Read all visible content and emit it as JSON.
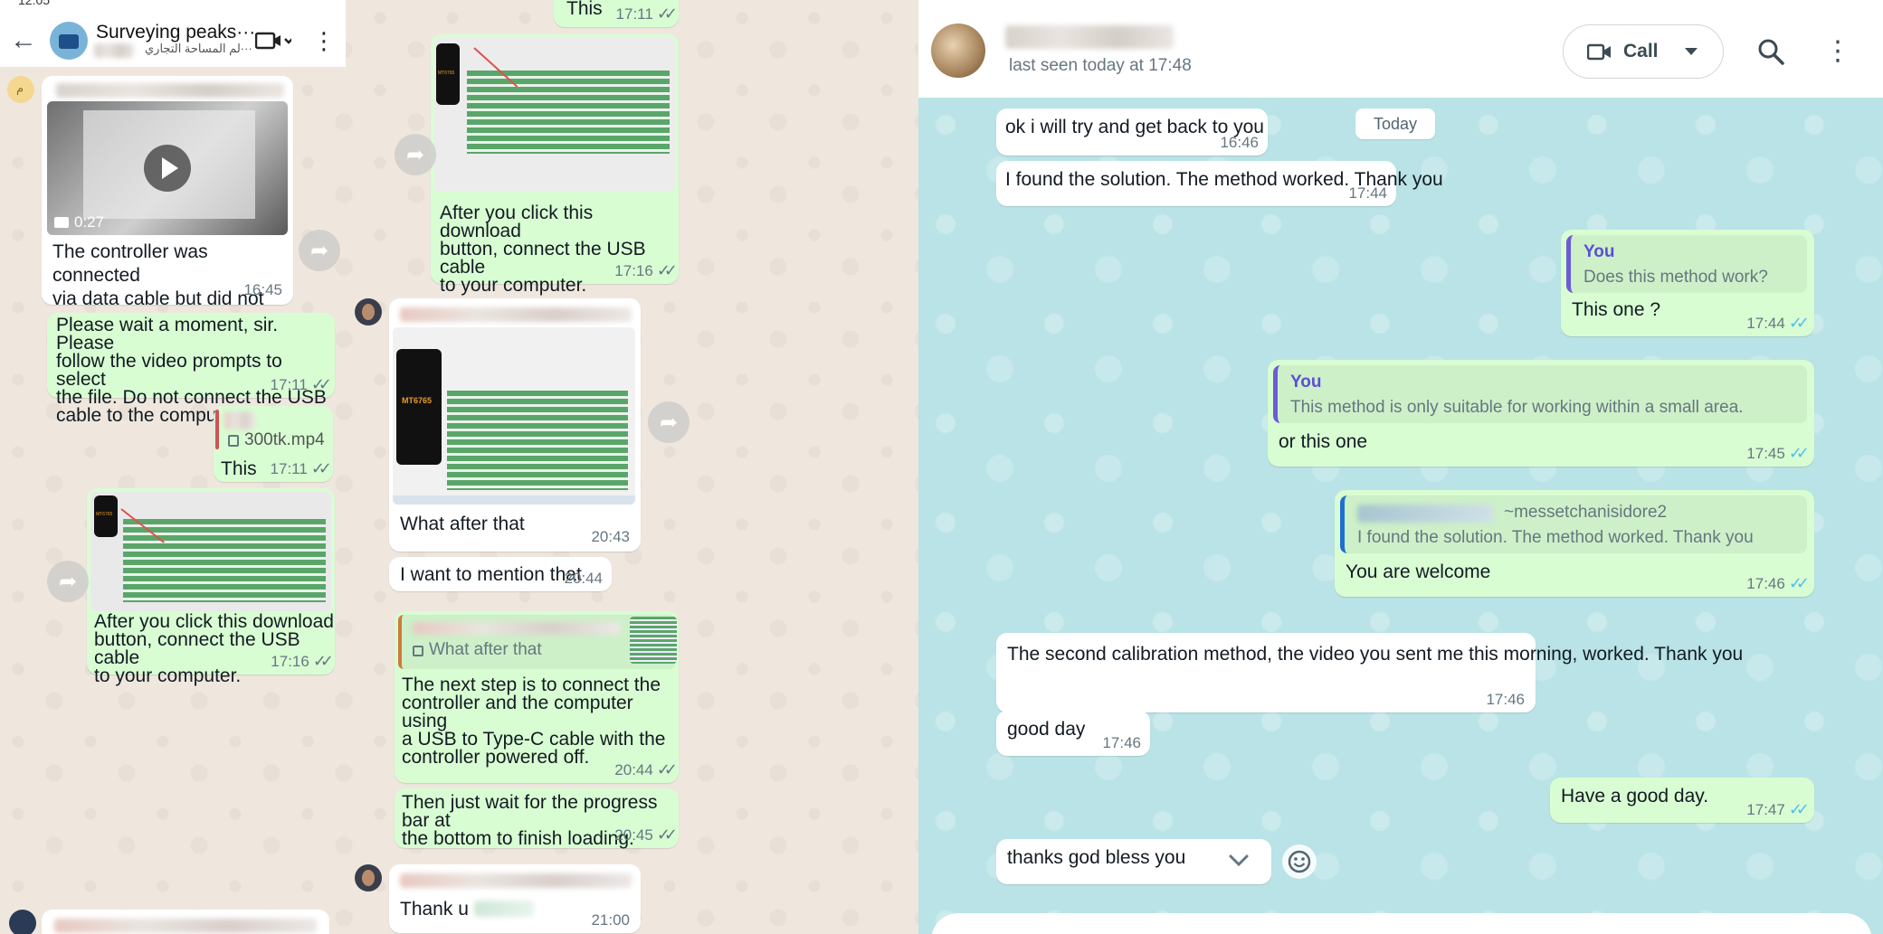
{
  "left_phone": {
    "status_time": "12:05",
    "header": {
      "title": "Surveying peaks···",
      "subtitle": "لم المساحة التجاري···"
    },
    "messages": {
      "video_duration": "0:27",
      "video_caption": "The controller was connected\nvia data cable but did not\nappear on the computer",
      "video_time": "16:45",
      "wait_text": "Please wait a moment, sir. Please\nfollow the video prompts to select\nthe file. Do not connect the USB\ncable to the computer yet.",
      "wait_time": "17:11",
      "file_name": "300tk.mp4",
      "this_text": "This",
      "this_time": "17:11",
      "download_caption": "After you click this download\nbutton, connect the USB cable\nto your computer.",
      "download_time": "17:16",
      "chip_label": "MT6765"
    }
  },
  "middle_phone": {
    "messages": {
      "top_this_text": "This",
      "top_this_time": "17:11",
      "download_caption": "After you click this download\nbutton, connect the USB cable\nto your computer.",
      "download_time": "17:16",
      "chip_label": "MT6765",
      "what_after_text": "What after that",
      "what_after_time": "20:43",
      "mention_text": "I want to mention that",
      "mention_time": "20:44",
      "quote_text": "What after that",
      "next_step_text": "The next step is to connect the\ncontroller and the computer using\na USB to Type-C cable with the\ncontroller powered off.",
      "next_step_time": "20:44",
      "progress_text": "Then just wait for the progress bar at\nthe bottom to finish loading.",
      "progress_time": "20:45",
      "thank_text": "Thank u",
      "thank_time": "21:00"
    }
  },
  "right_desktop": {
    "header": {
      "last_seen": "last seen today at 17:48",
      "call_label": "Call"
    },
    "date_chip": "Today",
    "messages": [
      {
        "text": "ok i will try and get back to you",
        "time": "16:46"
      },
      {
        "text": "I found the solution. The method worked. Thank you",
        "time": "17:44"
      },
      {
        "quote_name": "You",
        "quote_text": "Does this method work?",
        "text": "This one ?",
        "time": "17:44"
      },
      {
        "quote_name": "You",
        "quote_text": "This method is only suitable for working within a small area.",
        "text": "or this one",
        "time": "17:45"
      },
      {
        "quote_handle": "~messetchanisidore2",
        "quote_text": "I found the solution. The method worked. Thank you",
        "text": "You are welcome",
        "time": "17:46"
      },
      {
        "text": "The second calibration method, the video you sent me this\nmorning, worked. Thank you",
        "time": "17:46"
      },
      {
        "text": "good day",
        "time": "17:46"
      },
      {
        "text": "Have a good day.",
        "time": "17:47"
      },
      {
        "text": "thanks god bless you",
        "time": ""
      }
    ]
  },
  "colors": {
    "outgoing_bubble": "#d9fdd3",
    "incoming_bubble": "#ffffff",
    "read_tick": "#53bdeb",
    "quote_accent": "#6b5bd6",
    "right_wallpaper": "#b9e3e6"
  }
}
